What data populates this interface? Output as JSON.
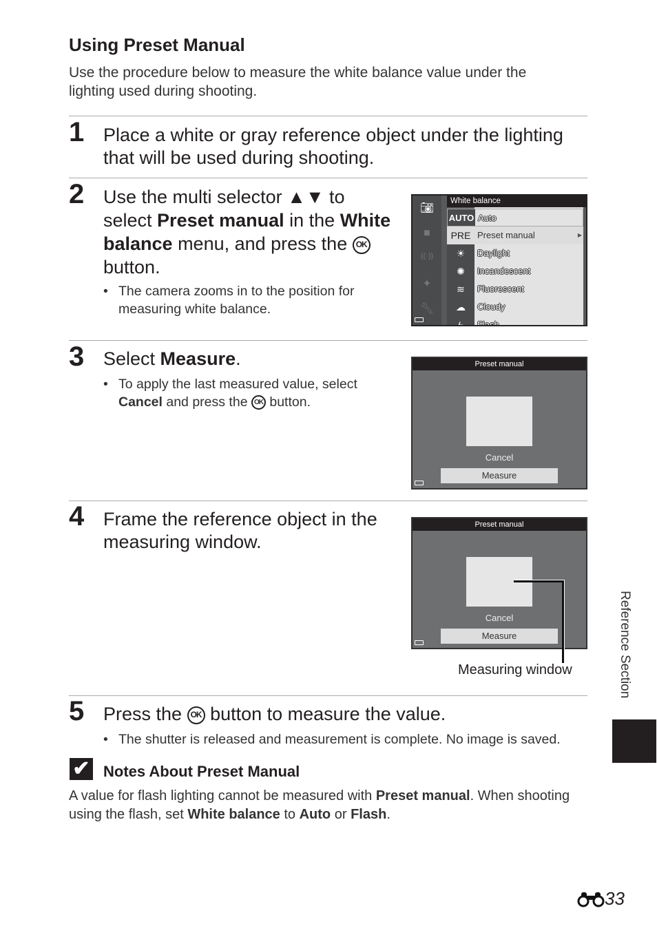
{
  "title": "Using Preset Manual",
  "intro": "Use the procedure below to measure the white balance value under the lighting used during shooting.",
  "steps": [
    {
      "num": "1",
      "text": "Place a white or gray reference object under the lighting that will be used during shooting."
    },
    {
      "num": "2",
      "t1": "Use the multi selector ▲▼ to select ",
      "b1": "Preset manual",
      "t2": " in the ",
      "b2": "White balance",
      "t3": " menu, and press the ",
      "ok": "OK",
      "t4": " button.",
      "bullet": "The camera zooms in to the position for measuring white balance."
    },
    {
      "num": "3",
      "t1": "Select ",
      "b1": "Measure",
      "t2": ".",
      "bullet_b": "Cancel",
      "bullet_pre": "To apply the last measured value, select ",
      "bullet_mid": " and press the ",
      "bullet_end": " button."
    },
    {
      "num": "4",
      "text": "Frame the reference object in the measuring window.",
      "callout": "Measuring window"
    },
    {
      "num": "5",
      "t1": "Press the ",
      "t2": " button to measure the value.",
      "bullet": "The shutter is released and measurement is complete. No image is saved."
    }
  ],
  "wb_menu": {
    "title": "White balance",
    "items": [
      {
        "icon": "AUTO",
        "label": "Auto"
      },
      {
        "icon": "PRE",
        "label": "Preset manual"
      },
      {
        "icon": "☀",
        "label": "Daylight"
      },
      {
        "icon": "✺",
        "label": "Incandescent"
      },
      {
        "icon": "≋",
        "label": "Fluorescent"
      },
      {
        "icon": "☁",
        "label": "Cloudy"
      },
      {
        "icon": "ϟ",
        "label": "Flash"
      }
    ],
    "selected": "Preset manual"
  },
  "preset_screen": {
    "title": "Preset manual",
    "cancel": "Cancel",
    "measure": "Measure"
  },
  "note": {
    "title": "Notes About Preset Manual",
    "p1": "A value for flash lighting cannot be measured with ",
    "b1": "Preset manual",
    "p2": ". When shooting using the flash, set ",
    "b2": "White balance",
    "p3": " to ",
    "b3": "Auto",
    "p4": " or ",
    "b4": "Flash",
    "p5": "."
  },
  "side_tab": "Reference Section",
  "page_number": "33"
}
